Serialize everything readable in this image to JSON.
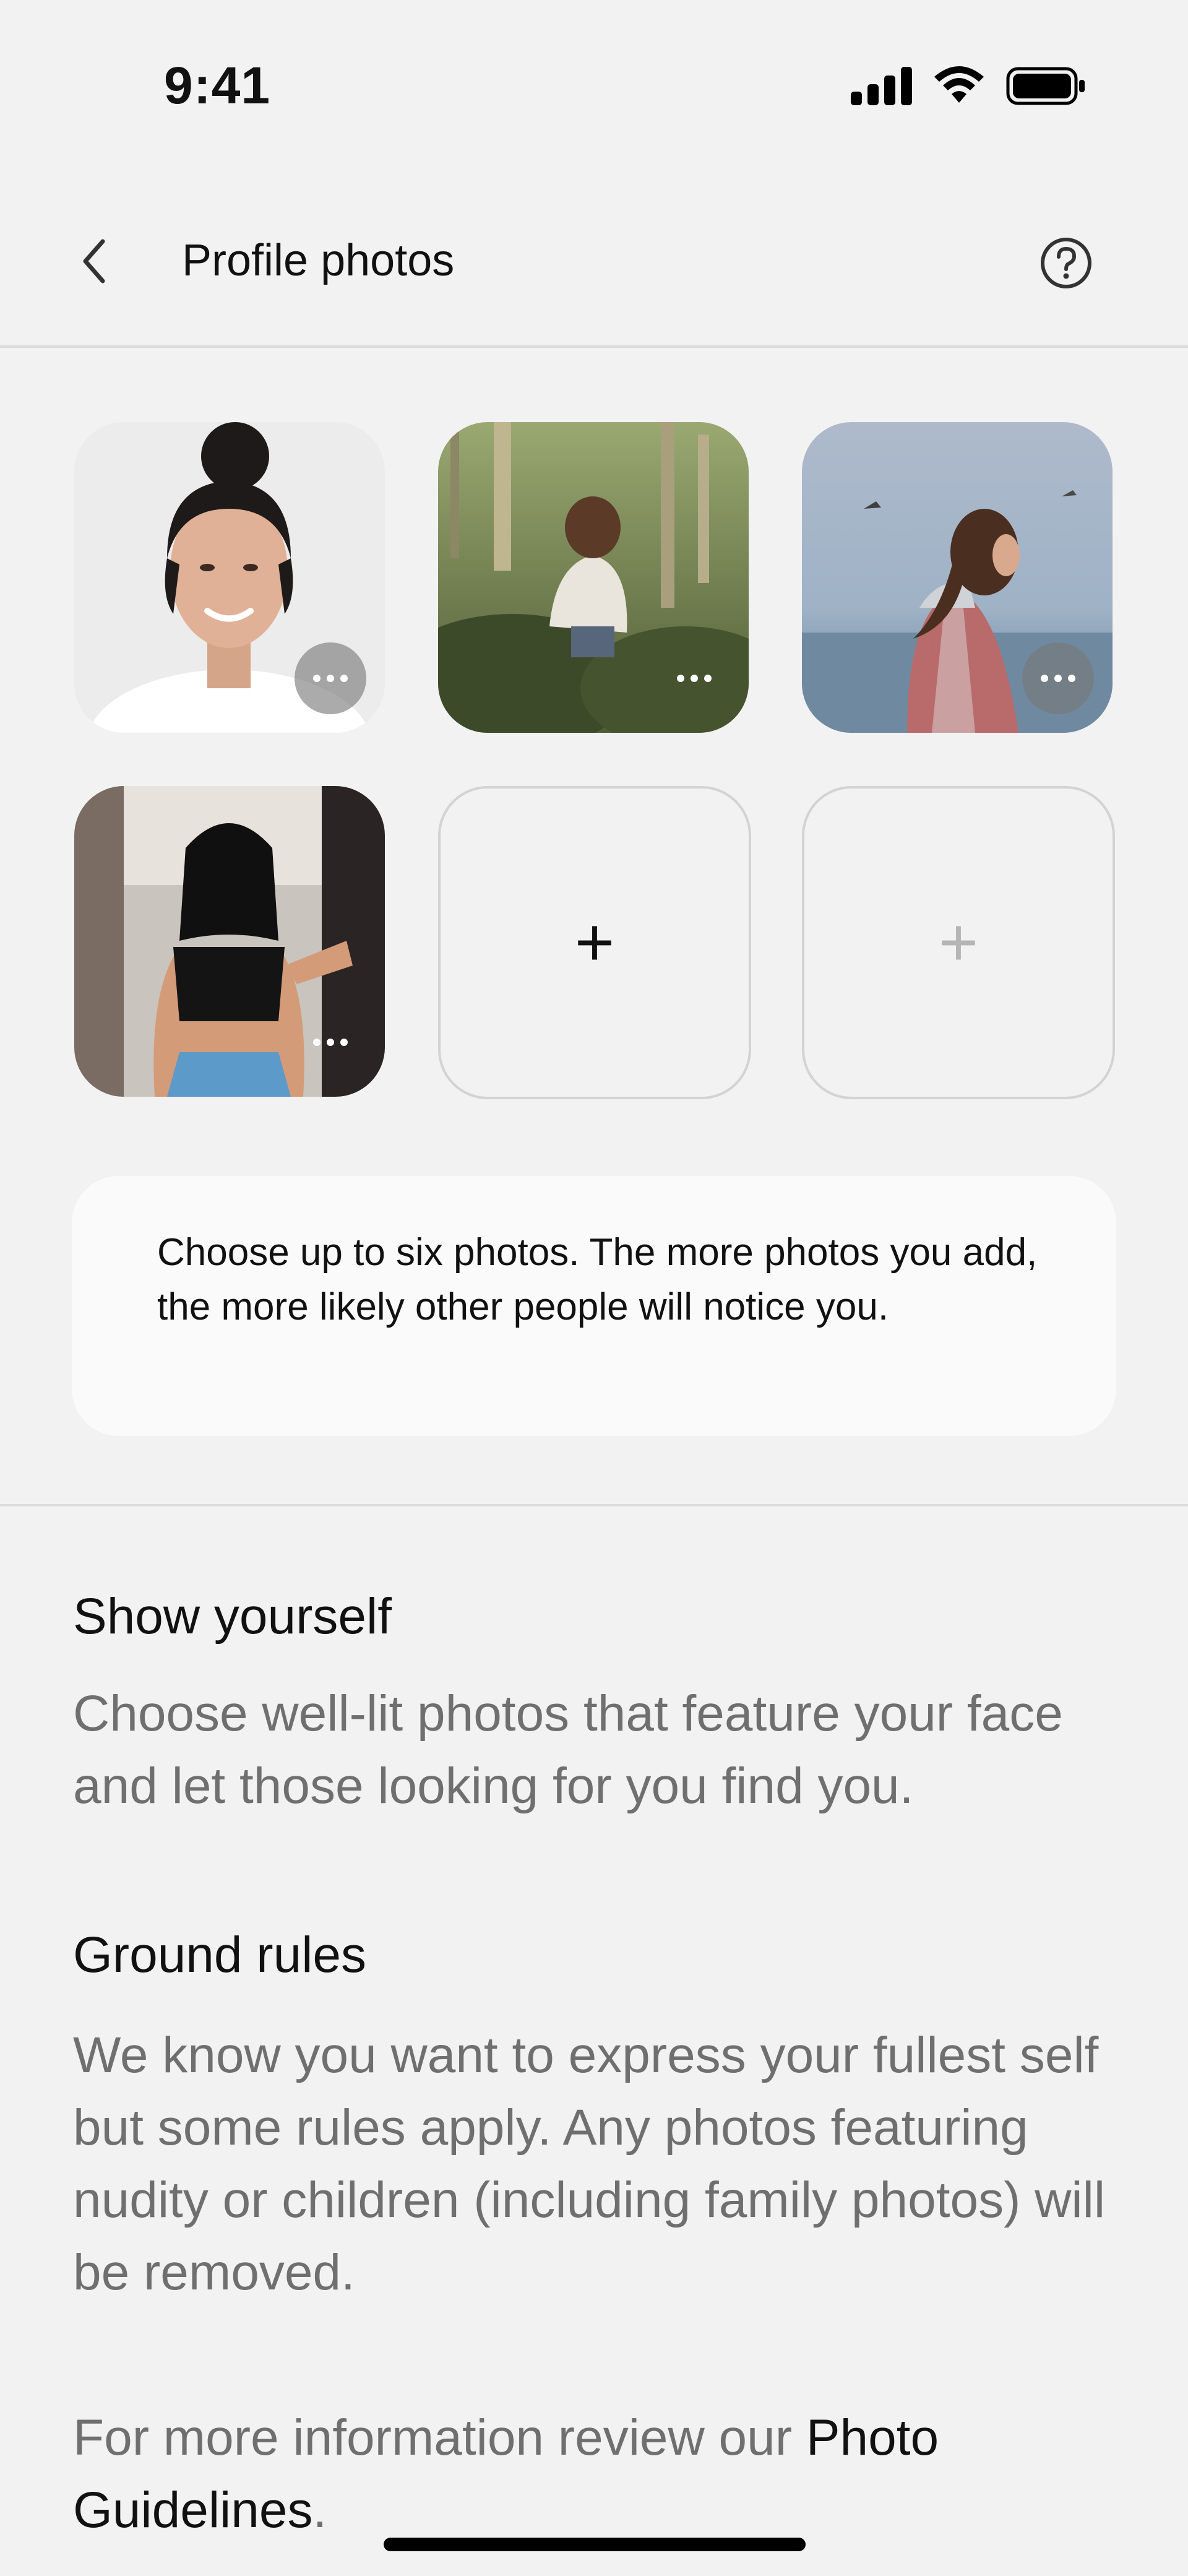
{
  "status_bar": {
    "time": "9:41"
  },
  "header": {
    "title": "Profile photos",
    "back_icon": "chevron-left-icon",
    "help_icon": "question-circle-icon"
  },
  "photos": {
    "slots": [
      {
        "filled": true,
        "alt": "photo-1"
      },
      {
        "filled": true,
        "alt": "photo-2"
      },
      {
        "filled": true,
        "alt": "photo-3"
      },
      {
        "filled": true,
        "alt": "photo-4"
      },
      {
        "filled": false,
        "add_label": "+"
      },
      {
        "filled": false,
        "add_label": "+"
      }
    ],
    "more_icon": "more-horizontal-icon"
  },
  "info_card": {
    "text": "Choose up to six photos. The more photos you add, the more likely other people will notice you."
  },
  "sections": {
    "show_yourself": {
      "title": "Show yourself",
      "body": "Choose well-lit photos that feature your face and let those looking for you find you."
    },
    "ground_rules": {
      "title": "Ground rules",
      "body": "We know you want to express your fullest self but some rules apply. Any photos featuring nudity or children (including family photos) will be removed."
    },
    "more_info": {
      "prefix": "For more information review our ",
      "link": "Photo Guidelines",
      "suffix": "."
    }
  },
  "colors": {
    "background": "#f2f2f2",
    "card": "#fafafa",
    "divider": "#dcdcdc",
    "secondary_text": "#6f6f6f",
    "primary_text": "#111111",
    "disabled_plus": "#b5b5b5"
  }
}
